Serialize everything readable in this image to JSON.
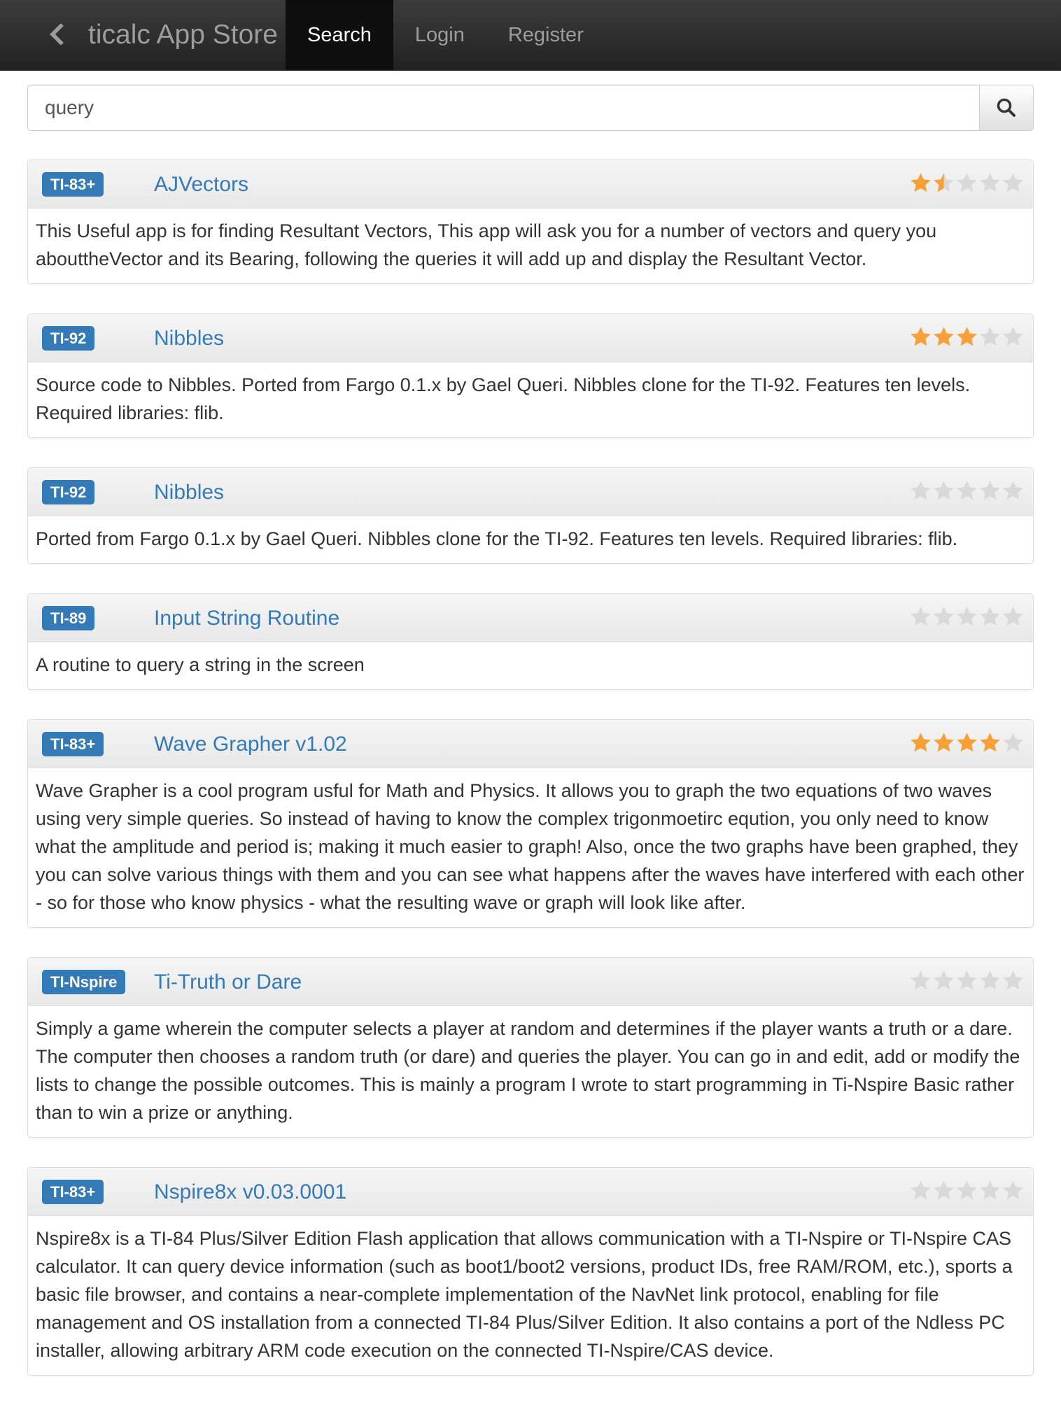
{
  "navbar": {
    "brand": "ticalc App Store",
    "back_icon": "chevron-left-icon",
    "items": [
      {
        "label": "Search",
        "active": true
      },
      {
        "label": "Login",
        "active": false
      },
      {
        "label": "Register",
        "active": false
      }
    ]
  },
  "search": {
    "value": "query",
    "placeholder": "",
    "button_icon": "search-icon"
  },
  "colors": {
    "navbar": "#222222",
    "link": "#337ab7",
    "badge": "#337ab7",
    "star_filled": "#f7a03a",
    "star_empty": "#d9d9d9"
  },
  "results": [
    {
      "platform": "TI-83+",
      "title": "AJVectors",
      "rating": 1.5,
      "description": "This Useful app is for finding Resultant Vectors, This app will ask you for a number of vectors and query you abouttheVector and its Bearing, following the queries it will add up and display the Resultant Vector."
    },
    {
      "platform": "TI-92",
      "title": "Nibbles",
      "rating": 3,
      "description": "Source code to Nibbles. Ported from Fargo 0.1.x by Gael Queri. Nibbles clone for the TI-92. Features ten levels. Required libraries: flib."
    },
    {
      "platform": "TI-92",
      "title": "Nibbles",
      "rating": 0,
      "description": "Ported from Fargo 0.1.x by Gael Queri. Nibbles clone for the TI-92. Features ten levels. Required libraries: flib."
    },
    {
      "platform": "TI-89",
      "title": "Input String Routine",
      "rating": 0,
      "description": "A routine to query a string in the screen"
    },
    {
      "platform": "TI-83+",
      "title": "Wave Grapher v1.02",
      "rating": 4,
      "description": "Wave Grapher is a cool program usful for Math and Physics. It allows you to graph the two equations of two waves using very simple queries. So instead of having to know the complex trigonmoetirc eqution, you only need to know what the amplitude and period is; making it much easier to graph! Also, once the two graphs have been graphed, they you can solve various things with them and you can see what happens after the waves have interfered with each other - so for those who know physics - what the resulting wave or graph will look like after."
    },
    {
      "platform": "TI-Nspire",
      "title": "Ti-Truth or Dare",
      "rating": 0,
      "description": "Simply a game wherein the computer selects a player at random and determines if the player wants a truth or a dare. The computer then chooses a random truth (or dare) and queries the player. You can go in and edit, add or modify the lists to change the possible outcomes. This is mainly a program I wrote to start programming in Ti-Nspire Basic rather than to win a prize or anything."
    },
    {
      "platform": "TI-83+",
      "title": "Nspire8x v0.03.0001",
      "rating": 0,
      "description": "Nspire8x is a TI-84 Plus/Silver Edition Flash application that allows communication with a TI-Nspire or TI-Nspire CAS calculator. It can query device information (such as boot1/boot2 versions, product IDs, free RAM/ROM, etc.), sports a basic file browser, and contains a near-complete implementation of the NavNet link protocol, enabling for file management and OS installation from a connected TI-84 Plus/Silver Edition. It also contains a port of the Ndless PC installer, allowing arbitrary ARM code execution on the connected TI-Nspire/CAS device."
    }
  ]
}
